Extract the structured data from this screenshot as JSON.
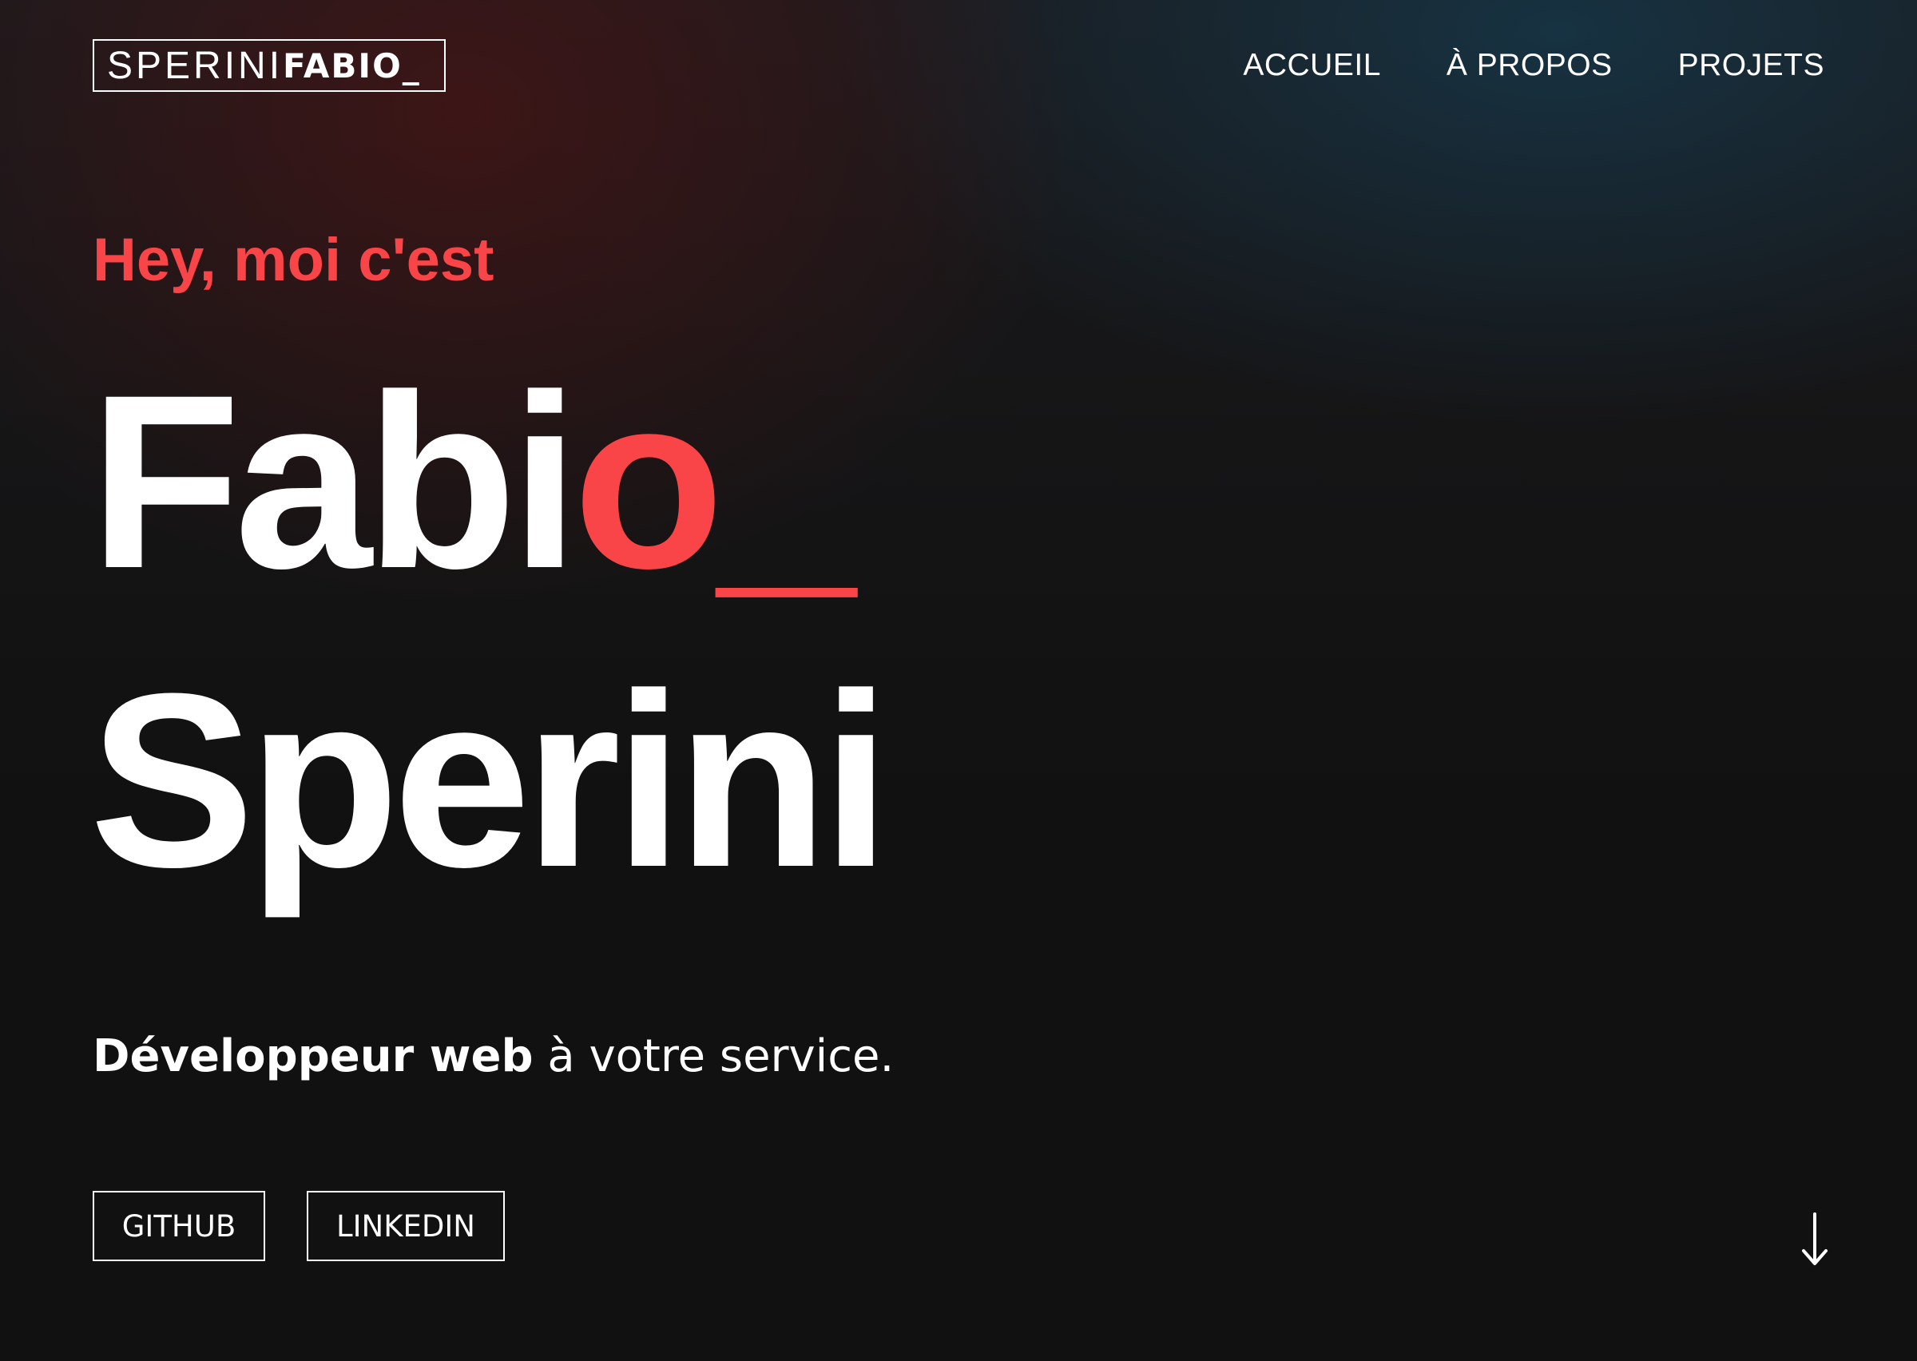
{
  "header": {
    "logo": {
      "light": "SPERINI",
      "bold": "FABIO_"
    },
    "nav": [
      {
        "label": "ACCUEIL"
      },
      {
        "label": "À PROPOS"
      },
      {
        "label": "PROJETS"
      }
    ]
  },
  "hero": {
    "greeting": "Hey, moi c'est",
    "first_name_main": "Fabi",
    "first_name_accent": "o_",
    "last_name": "Sperini",
    "tagline_bold": "Développeur web",
    "tagline_rest": " à votre service.",
    "buttons": [
      {
        "label": "GITHUB"
      },
      {
        "label": "LINKEDIN"
      }
    ],
    "scroll_icon": "arrow-down-icon"
  },
  "colors": {
    "accent": "#fa4548",
    "background": "#111111",
    "text": "#ffffff"
  }
}
